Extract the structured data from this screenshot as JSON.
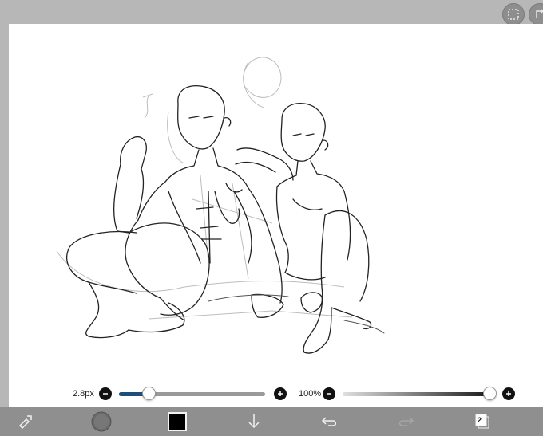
{
  "brush_slider": {
    "label": "2.8px",
    "fill_fraction": 0.2
  },
  "opacity_slider": {
    "label": "100%",
    "fill_fraction": 1.0
  },
  "toolbar": {
    "layer_count": "2"
  },
  "colors": {
    "accent": "#1e4f7a",
    "toolbar": "#8f8f8f",
    "frame": "#b7b7b7",
    "current_color": "#000000"
  },
  "icons": {
    "top_right": [
      "selection-icon",
      "transform-icon"
    ],
    "toolbar": [
      "tools-icon",
      "brush-preview-icon",
      "color-swatch-icon",
      "download-icon",
      "undo-icon",
      "redo-icon",
      "layers-icon"
    ]
  }
}
